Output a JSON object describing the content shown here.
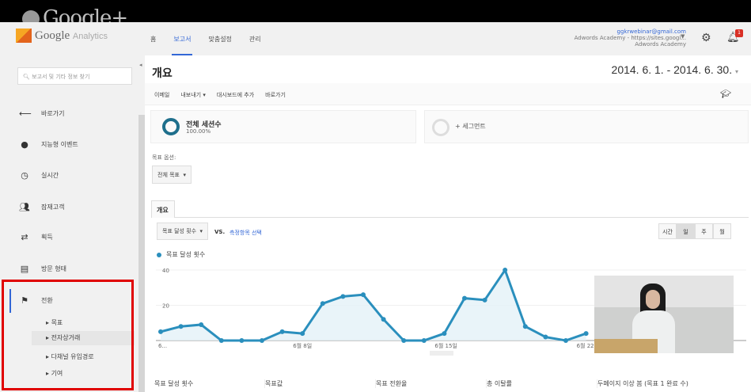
{
  "overlay": {
    "watermark": "Google+"
  },
  "header": {
    "logo": "Google",
    "logo_sub": "Analytics",
    "nav": [
      "홈",
      "보고서",
      "맞춤설정",
      "관리"
    ],
    "active_nav": 1,
    "account": {
      "email": "ggkrwebinar@gmail.com",
      "property": "Adwords Academy - https://sites.googl...",
      "view": "Adwords Academy"
    },
    "notification_count": "1",
    "icons": [
      "gear-icon",
      "bell-icon"
    ]
  },
  "sidebar": {
    "search_placeholder": "보고서 및 기타 정보 찾기",
    "items": [
      {
        "label": "바로가기",
        "icon": "arrow-left-icon"
      },
      {
        "label": "지능형 이벤트",
        "icon": "lightbulb-icon"
      },
      {
        "label": "실시간",
        "icon": "clock-icon"
      },
      {
        "label": "잠재고객",
        "icon": "people-icon"
      },
      {
        "label": "획득",
        "icon": "arrows-icon"
      },
      {
        "label": "방문 형태",
        "icon": "layout-icon"
      },
      {
        "label": "전환",
        "icon": "flag-icon"
      }
    ],
    "subitems": [
      "목표",
      "전자상거래",
      "다채널 유입경로",
      "기여"
    ],
    "highlighted_sub": 1
  },
  "main": {
    "title": "개요",
    "date_range": "2014. 6. 1. - 2014. 6. 30.",
    "toolbar": [
      "이메일",
      "내보내기 ▾",
      "대시보드에 추가",
      "바로가기"
    ],
    "segment": {
      "name": "전체 세션수",
      "pct": "100.00%",
      "add": "+ 세그먼트"
    },
    "goal_option_label": "목표 옵션:",
    "goal_option_value": "전체 목표",
    "tab": "개요",
    "metric_select": "목표 달성 횟수",
    "vs": "VS.",
    "pick_metric": "측정항목 선택",
    "granularity": [
      "시간",
      "일",
      "주",
      "월"
    ],
    "granularity_selected": 1,
    "metrics": [
      "목표 달성 횟수",
      "목표값",
      "목표 전환율",
      "총 이탈률",
      "두페이지 이상 봄 (목표 1 완료 수)"
    ],
    "accent": "#2a8fbd"
  },
  "chart_data": {
    "type": "area",
    "series": [
      {
        "name": "목표 달성 횟수",
        "values": [
          5,
          8,
          9,
          0,
          0,
          0,
          5,
          4,
          21,
          25,
          26,
          12,
          0,
          0,
          4,
          24,
          23,
          40,
          8,
          2,
          0,
          4
        ]
      }
    ],
    "x": [
      "6/1",
      "6/2",
      "6/3",
      "6/4",
      "6/5",
      "6/6",
      "6/7",
      "6/8",
      "6/9",
      "6/10",
      "6/11",
      "6/12",
      "6/13",
      "6/14",
      "6/15",
      "6/16",
      "6/17",
      "6/18",
      "6/19",
      "6/20",
      "6/21",
      "6/22"
    ],
    "x_tick_labels": [
      "6...",
      "6월 8일",
      "6월 15일",
      "6월 22일"
    ],
    "y_tick_labels": [
      "40",
      "20"
    ],
    "ylim": [
      0,
      40
    ]
  }
}
